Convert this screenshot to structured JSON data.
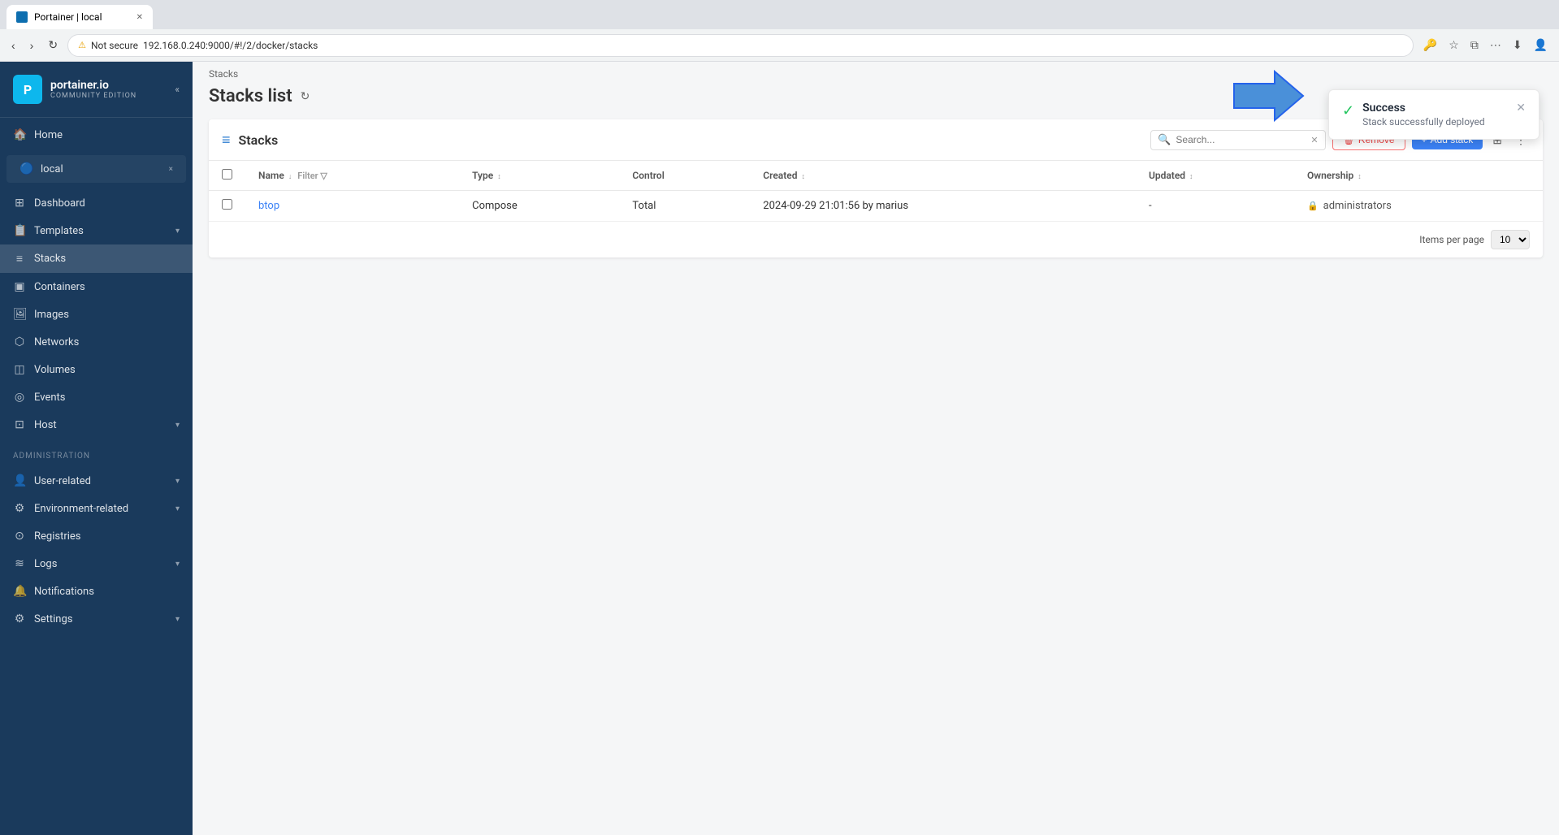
{
  "browser": {
    "tab_title": "Portainer | local",
    "tab_favicon": "P",
    "address": "192.168.0.240:9000/#!/2/docker/stacks",
    "security_label": "Not secure"
  },
  "sidebar": {
    "logo_text": "portainer.io",
    "logo_subtext": "COMMUNITY EDITION",
    "collapse_icon": "«",
    "home_label": "Home",
    "env_name": "local",
    "env_close": "×",
    "nav_items": [
      {
        "id": "dashboard",
        "label": "Dashboard",
        "icon": "⊞"
      },
      {
        "id": "templates",
        "label": "Templates",
        "icon": "⬚",
        "has_chevron": true
      },
      {
        "id": "stacks",
        "label": "Stacks",
        "icon": "≡",
        "active": true
      },
      {
        "id": "containers",
        "label": "Containers",
        "icon": "▣"
      },
      {
        "id": "images",
        "label": "Images",
        "icon": "≡"
      },
      {
        "id": "networks",
        "label": "Networks",
        "icon": "⬡"
      },
      {
        "id": "volumes",
        "label": "Volumes",
        "icon": "◫"
      },
      {
        "id": "events",
        "label": "Events",
        "icon": "◎"
      },
      {
        "id": "host",
        "label": "Host",
        "icon": "⊡",
        "has_chevron": true
      }
    ],
    "admin_section_label": "Administration",
    "admin_items": [
      {
        "id": "user-related",
        "label": "User-related",
        "icon": "◉",
        "has_chevron": true
      },
      {
        "id": "environment-related",
        "label": "Environment-related",
        "icon": "◈",
        "has_chevron": true
      },
      {
        "id": "registries",
        "label": "Registries",
        "icon": "⊙"
      },
      {
        "id": "logs",
        "label": "Logs",
        "icon": "≋",
        "has_chevron": true
      },
      {
        "id": "notifications",
        "label": "Notifications",
        "icon": "🔔"
      },
      {
        "id": "settings",
        "label": "Settings",
        "icon": "⚙",
        "has_chevron": true
      }
    ]
  },
  "breadcrumb": "Stacks",
  "page_title": "Stacks list",
  "panel": {
    "title": "Stacks",
    "search_placeholder": "Search...",
    "remove_label": "Remove",
    "add_label": "Add stack",
    "columns": {
      "name": "Name",
      "type": "Type",
      "control": "Control",
      "created": "Created",
      "updated": "Updated",
      "ownership": "Ownership"
    },
    "rows": [
      {
        "name": "btop",
        "type": "Compose",
        "control": "Total",
        "created": "2024-09-29 21:01:56 by marius",
        "updated": "-",
        "ownership": "administrators"
      }
    ],
    "items_per_page_label": "Items per page",
    "items_per_page_value": "10"
  },
  "notification": {
    "title": "Success",
    "message": "Stack successfully deployed",
    "icon": "✓"
  }
}
